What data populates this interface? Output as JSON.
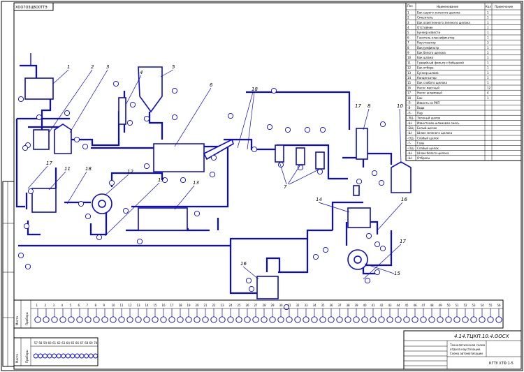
{
  "stamp": {
    "top_left": "ХОО7О3ЦВО0ТТЭ"
  },
  "spec_table": {
    "headers": {
      "pos": "Поз",
      "name": "Наименование",
      "qty": "Кол",
      "note": "Примечание"
    },
    "rows": [
      {
        "pos": "1",
        "name": "Бак сырого зеленого щелока",
        "qty": "1"
      },
      {
        "pos": "2",
        "name": "Смеситель",
        "qty": "1"
      },
      {
        "pos": "3",
        "name": "Бак осветленного зеленого щелока",
        "qty": "1"
      },
      {
        "pos": "4",
        "name": "Отстойник",
        "qty": "1"
      },
      {
        "pos": "5",
        "name": "Бункер извести",
        "qty": "1"
      },
      {
        "pos": "6",
        "name": "Гаситель-классификатор",
        "qty": "1"
      },
      {
        "pos": "7",
        "name": "Каустизатор",
        "qty": "3"
      },
      {
        "pos": "8",
        "name": "Вакуумфильтр",
        "qty": "1"
      },
      {
        "pos": "9",
        "name": "Бак белого щелока",
        "qty": "1"
      },
      {
        "pos": "10",
        "name": "Бак шлама",
        "qty": "1"
      },
      {
        "pos": "11",
        "name": "Гравийный фильтр с бобышкой",
        "qty": "1"
      },
      {
        "pos": "12",
        "name": "Бак отбора",
        "qty": "1"
      },
      {
        "pos": "13",
        "name": "Бункер шлама",
        "qty": "1"
      },
      {
        "pos": "14",
        "name": "Конденсатор",
        "qty": "1"
      },
      {
        "pos": "15",
        "name": "Бак слабого щелока",
        "qty": "1"
      },
      {
        "pos": "16",
        "name": "Насос массный",
        "qty": "12"
      },
      {
        "pos": "17",
        "name": "Насос шламовый",
        "qty": "4"
      },
      {
        "pos": "18",
        "name": "Бак",
        "qty": "1"
      },
      {
        "pos": "-П-",
        "name": "Известь из РКП"
      },
      {
        "pos": "-В-",
        "name": "Вода"
      },
      {
        "pos": "-П-",
        "name": "Пар"
      },
      {
        "pos": "-ЗЩ-",
        "name": "Зеленый щелок"
      },
      {
        "pos": "-Ш-",
        "name": "Известково-шламовая смесь"
      },
      {
        "pos": "-БЩ-",
        "name": "Белый щелок"
      },
      {
        "pos": "-Ш-",
        "name": "Шлам зеленого щелока"
      },
      {
        "pos": "-СЩ-",
        "name": "Слабый щелок"
      },
      {
        "pos": "-Т-",
        "name": "Газы"
      },
      {
        "pos": "-СЩ-",
        "name": "Слабый щелок"
      },
      {
        "pos": "-Ш-",
        "name": "Шлам белого щелока"
      },
      {
        "pos": "-Ш-",
        "name": "Отбросы"
      }
    ]
  },
  "equipment_callouts": [
    "1",
    "2",
    "3",
    "4",
    "5",
    "6",
    "7",
    "8",
    "9",
    "10",
    "11",
    "12",
    "13",
    "14",
    "15",
    "16",
    "17",
    "18"
  ],
  "instrument_row": {
    "left_labels": [
      "Место",
      "Приборы"
    ],
    "numbers_top": [
      "1",
      "2",
      "3",
      "4",
      "5",
      "6",
      "7",
      "8",
      "9",
      "10",
      "11",
      "12",
      "13",
      "14",
      "15",
      "16",
      "17",
      "18",
      "19",
      "20",
      "21",
      "22",
      "23",
      "24",
      "25",
      "26",
      "27",
      "28",
      "29",
      "30",
      "31",
      "32",
      "33",
      "34",
      "35",
      "36",
      "37",
      "38",
      "39",
      "40",
      "41",
      "42",
      "43",
      "44",
      "45",
      "46",
      "47",
      "48",
      "49",
      "50",
      "51",
      "52",
      "53",
      "54",
      "55",
      "56"
    ],
    "numbers_bottom": [
      "57",
      "58",
      "59",
      "60",
      "61",
      "62",
      "63",
      "64",
      "65",
      "66",
      "67",
      "68",
      "69",
      "70"
    ]
  },
  "title_block": {
    "code": "4.14.ТЦКП.10.4.ООСХ",
    "title_line1": "Технологическая схема",
    "title_line2": "отдела каустизации.",
    "title_line3": "Схема автоматизации",
    "org": "КГТУ ХТФ 1-5"
  }
}
